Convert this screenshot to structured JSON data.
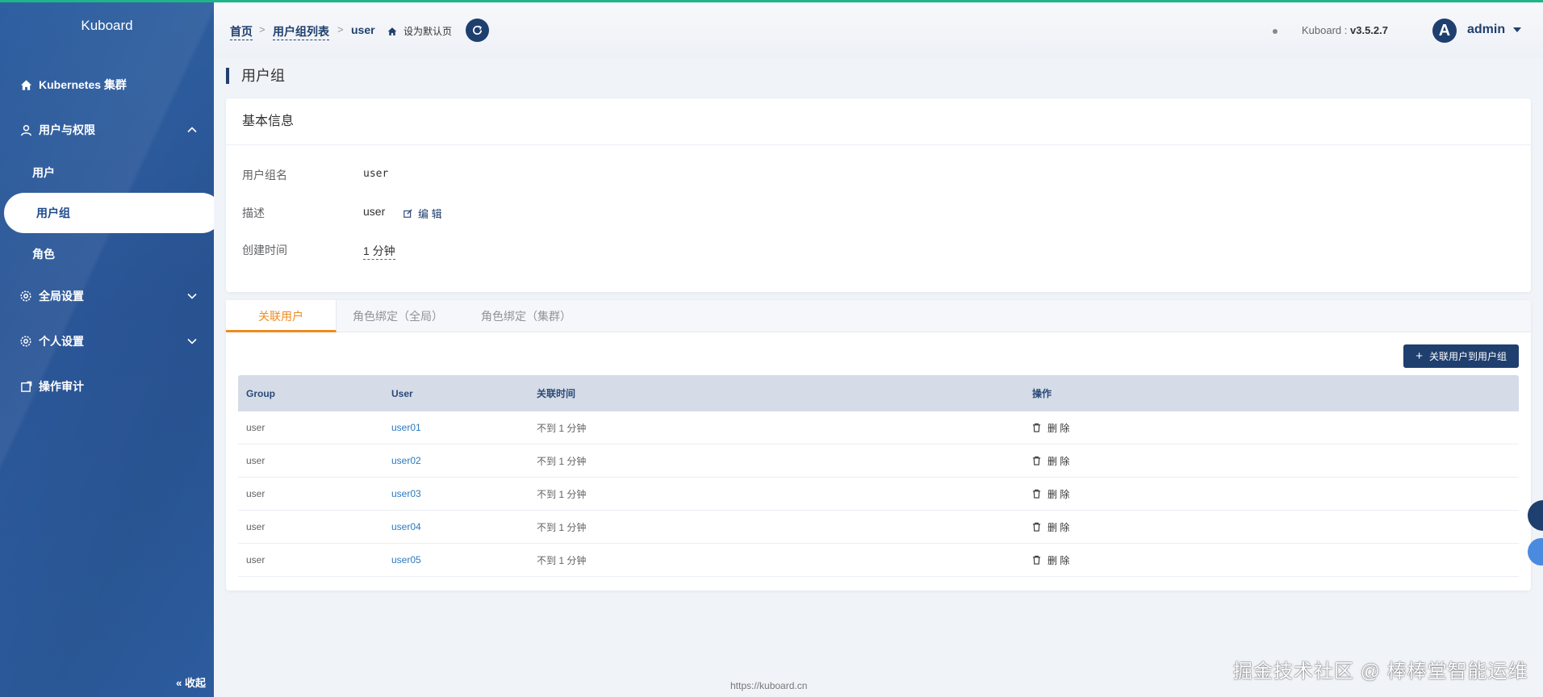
{
  "app": {
    "brand": "Kuboard",
    "version_label": "Kuboard :",
    "version": "v3.5.2.7",
    "footer_url": "https://kuboard.cn"
  },
  "sidebar": {
    "items": [
      {
        "label": "Kubernetes 集群",
        "icon": "home-icon"
      },
      {
        "label": "用户与权限",
        "icon": "user-icon"
      },
      {
        "label": "全局设置",
        "icon": "gear-icon"
      },
      {
        "label": "个人设置",
        "icon": "gear-icon"
      },
      {
        "label": "操作审计",
        "icon": "audit-icon"
      }
    ],
    "sub_items": [
      {
        "label": "用户"
      },
      {
        "label": "用户组"
      },
      {
        "label": "角色"
      }
    ],
    "collapse_label": "收起"
  },
  "header": {
    "breadcrumb": [
      "首页",
      "用户组列表",
      "user"
    ],
    "set_default": "设为默认页",
    "user": {
      "avatar": "A",
      "name": "admin"
    }
  },
  "page": {
    "title": "用户组"
  },
  "basic": {
    "title": "基本信息",
    "group_name_label": "用户组名",
    "group_name": "user",
    "desc_label": "描述",
    "desc": "user",
    "edit_label": "编 辑",
    "created_label": "创建时间",
    "created": "1 分钟"
  },
  "tabs": [
    "关联用户",
    "角色绑定（全局）",
    "角色绑定（集群）"
  ],
  "add_button": "关联用户到用户组",
  "table": {
    "headers": [
      "Group",
      "User",
      "关联时间",
      "操作"
    ],
    "rows": [
      {
        "group": "user",
        "user": "user01",
        "time": "不到 1 分钟",
        "action": "删 除"
      },
      {
        "group": "user",
        "user": "user02",
        "time": "不到 1 分钟",
        "action": "删 除"
      },
      {
        "group": "user",
        "user": "user03",
        "time": "不到 1 分钟",
        "action": "删 除"
      },
      {
        "group": "user",
        "user": "user04",
        "time": "不到 1 分钟",
        "action": "删 除"
      },
      {
        "group": "user",
        "user": "user05",
        "time": "不到 1 分钟",
        "action": "删 除"
      }
    ]
  },
  "watermark": "掘金技术社区 @ 棒棒堂智能运维",
  "colors": {
    "primary": "#1f3f6e",
    "sidebar": "#2a5596",
    "accent": "#f08b21",
    "link": "#2a7ac0",
    "top_bar": "#1fb48a"
  }
}
